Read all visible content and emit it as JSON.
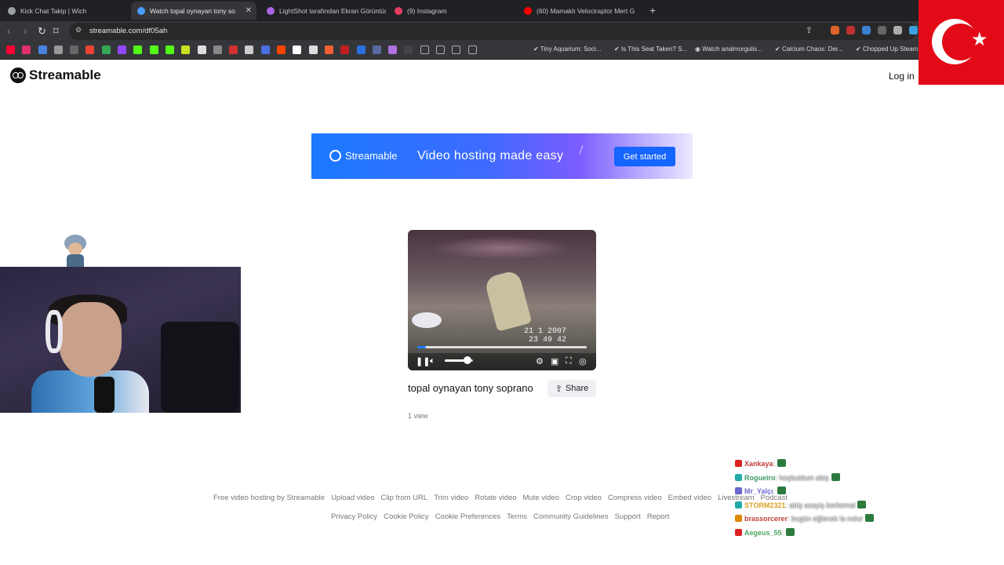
{
  "browser": {
    "tabs": [
      {
        "title": "Kick Chat Takip | Wich",
        "color": "#9aa0a6"
      },
      {
        "title": "Watch topal oynayan tony so",
        "color": "#4a9dff",
        "active": true
      },
      {
        "title": "LightShot tarafından Ekran Görüntüs",
        "color": "#a865e8"
      },
      {
        "title": "(9) Instagram",
        "color": "#e4405f"
      },
      {
        "title": "(60) Mamaklı Velociraptor Mert G",
        "color": "#ff0000"
      }
    ],
    "url": "streamable.com/df05ah",
    "bookmarks": [
      "Tiny Aquarium: Soci...",
      "Is This Seat Taken? S...",
      "Watch analmorgulis...",
      "Calcium Chaos: Der...",
      "Chopped Up Steam"
    ]
  },
  "header": {
    "brand": "Streamable",
    "login": "Log in"
  },
  "banner": {
    "brand": "Streamable",
    "tagline": "Video hosting made easy",
    "cta": "Get started"
  },
  "video": {
    "timestamp_date": "21 1 2007",
    "timestamp_time": "23 49 42",
    "progress": 0.05,
    "volume": 0.8,
    "title": "topal oynayan tony soprano",
    "views": "1 view",
    "share_label": "Share"
  },
  "footer": {
    "row1": [
      "Free video hosting by Streamable",
      "Upload video",
      "Clip from URL",
      "Trim video",
      "Rotate video",
      "Mute video",
      "Crop video",
      "Compress video",
      "Embed video",
      "Livestream",
      "Podcast"
    ],
    "row2": [
      "Privacy Policy",
      "Cookie Policy",
      "Cookie Preferences",
      "Terms",
      "Community Guidelines",
      "Support",
      "Report"
    ]
  },
  "chat": [
    {
      "user": "Xankaya",
      "msg": ":",
      "color": "#c23b3b",
      "badge": "#d22"
    },
    {
      "user": "Rogueiro",
      "msg": ": hoşbuldum abiş",
      "color": "#3a9a6a",
      "badge": "#2aa"
    },
    {
      "user": "Mr_Yalçı",
      "msg": ":",
      "color": "#6a6ad0",
      "badge": "#66c"
    },
    {
      "user": "STORM2321",
      "msg": ": abiş asayiş berkemal",
      "color": "#d8a020",
      "badge": "#2aa"
    },
    {
      "user": "brassorcerer",
      "msg": ": bugün eğlenek la nolur",
      "color": "#c04040",
      "badge": "#d80"
    },
    {
      "user": "Aegeus_55",
      "msg": ":",
      "color": "#4aa860",
      "badge": "#d22"
    }
  ]
}
